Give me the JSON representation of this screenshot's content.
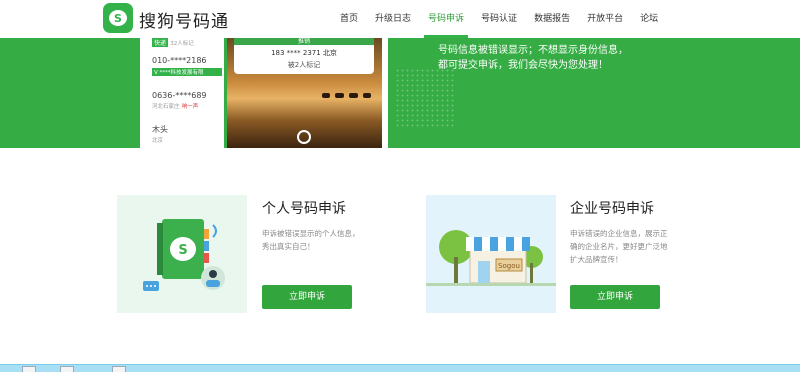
{
  "header": {
    "brand": "搜狗号码通",
    "nav": [
      {
        "label": "首页",
        "active": false
      },
      {
        "label": "升级日志",
        "active": false
      },
      {
        "label": "号码申诉",
        "active": true
      },
      {
        "label": "号码认证",
        "active": false
      },
      {
        "label": "数据报告",
        "active": false
      },
      {
        "label": "开放平台",
        "active": false
      },
      {
        "label": "论坛",
        "active": false
      }
    ]
  },
  "banner": {
    "phone_list": {
      "row1_tag": "快递",
      "row1_sub": "32人标记",
      "row2_number": "010-****2186",
      "row2_tag": "V ****科技发展有限",
      "row3_number": "0636-****689",
      "row3_sub": "河北石家庄",
      "row3_flag": "响一声",
      "row4_name": "木头",
      "row4_sub": "北京"
    },
    "photo_card": {
      "header": "推销",
      "number": "183 **** 2371  北京",
      "marked": "被2人标记"
    },
    "text_line1": "号码信息被错误显示；不想显示身份信息，",
    "text_line2": "都可提交申诉，我们会尽快为您处理！"
  },
  "personal": {
    "title": "个人号码申诉",
    "desc_line1": "申诉被错误显示的个人信息，",
    "desc_line2": "秀出真实自己！",
    "button": "立即申诉"
  },
  "enterprise": {
    "title": "企业号码申诉",
    "desc_line1": "申诉错误的企业信息，展示正",
    "desc_line2": "确的企业名片，更好更广泛地",
    "desc_line3": "扩大品牌宣传！",
    "shop_sign": "Sogou",
    "button": "立即申诉"
  },
  "colors": {
    "brand_green": "#33b24a",
    "banner_green": "#35ad44",
    "button_green": "#32a63c"
  }
}
